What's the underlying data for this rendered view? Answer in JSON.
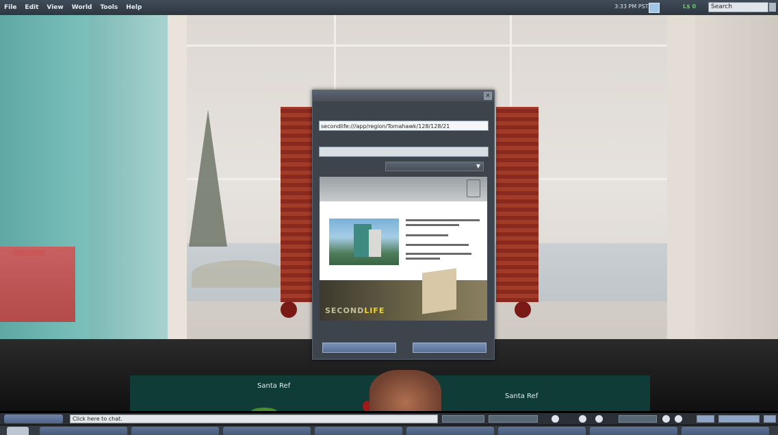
{
  "menubar": {
    "items": [
      "File",
      "Edit",
      "View",
      "World",
      "Tools",
      "Help"
    ],
    "status_text": "",
    "clock": "3:33 PM PST",
    "money": "L$ 0",
    "search_placeholder": "Search"
  },
  "dialog": {
    "title": "",
    "url_label": "",
    "url_value": "secondlife:///app/region/Tomahawk/128/128/21",
    "password_label": "",
    "password_value": "",
    "grid_label": "",
    "grid_value": "",
    "splash": {
      "heading": "",
      "brand_prefix": "SECOND",
      "brand_suffix": "LIFE"
    },
    "buttons": {
      "left": "",
      "right": ""
    }
  },
  "scene": {
    "name_tag_left": "Santa Ref",
    "name_tag_right": "Santa Ref",
    "name_tag_center": ""
  },
  "chatbar": {
    "placeholder": "Click here to chat."
  }
}
